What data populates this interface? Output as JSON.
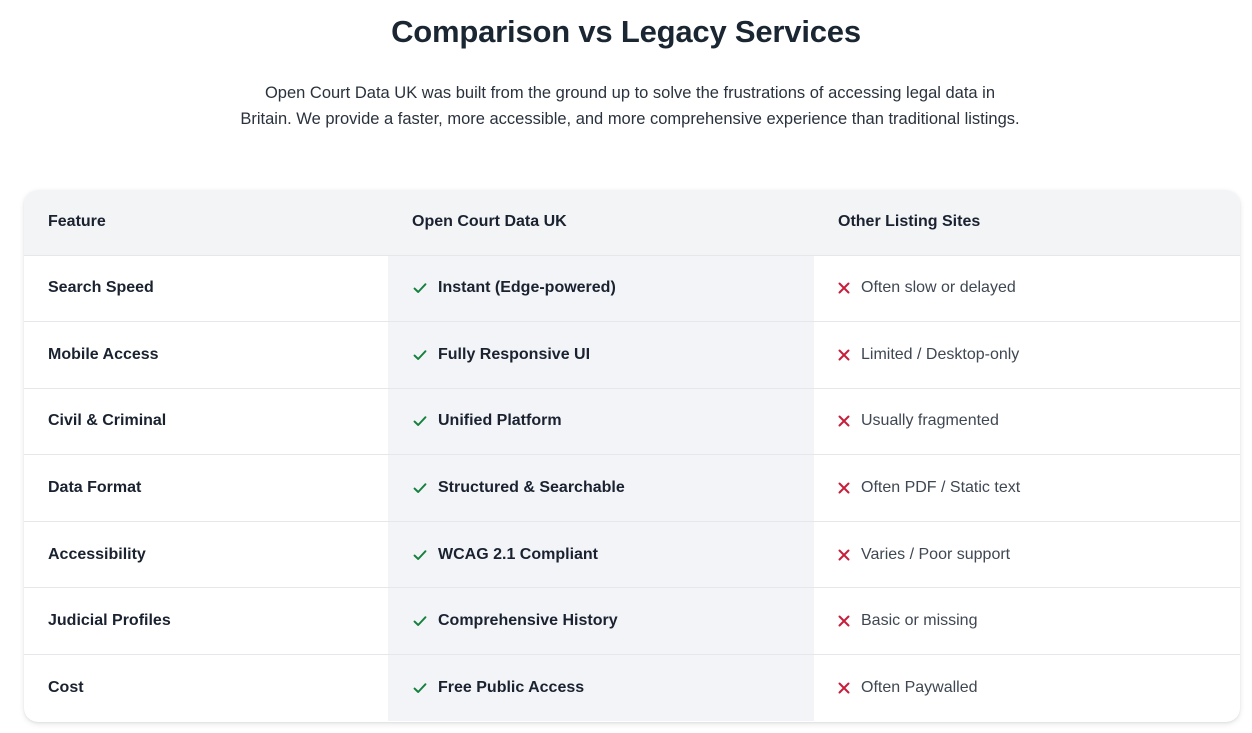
{
  "section": {
    "title": "Comparison vs Legacy Services",
    "intro": "Open Court Data UK was built from the ground up to solve the frustrations of accessing legal data in Britain. We provide a faster, more accessible, and more comprehensive experience than traditional listings."
  },
  "colors": {
    "check": "#15803d",
    "cross": "#c81e3a",
    "highlight_column": "#f3f4f8",
    "header_bg": "#f3f4f6"
  },
  "table": {
    "headers": [
      "Feature",
      "Open Court Data UK",
      "Other Listing Sites"
    ],
    "icons": {
      "ours": "check-icon",
      "others": "x-icon"
    },
    "rows": [
      {
        "feature": "Search Speed",
        "ours": "Instant (Edge-powered)",
        "others": "Often slow or delayed"
      },
      {
        "feature": "Mobile Access",
        "ours": "Fully Responsive UI",
        "others": "Limited / Desktop-only"
      },
      {
        "feature": "Civil & Criminal",
        "ours": "Unified Platform",
        "others": "Usually fragmented"
      },
      {
        "feature": "Data Format",
        "ours": "Structured & Searchable",
        "others": "Often PDF / Static text"
      },
      {
        "feature": "Accessibility",
        "ours": "WCAG 2.1 Compliant",
        "others": "Varies / Poor support"
      },
      {
        "feature": "Judicial Profiles",
        "ours": "Comprehensive History",
        "others": "Basic or missing"
      },
      {
        "feature": "Cost",
        "ours": "Free Public Access",
        "others": "Often Paywalled"
      }
    ]
  }
}
